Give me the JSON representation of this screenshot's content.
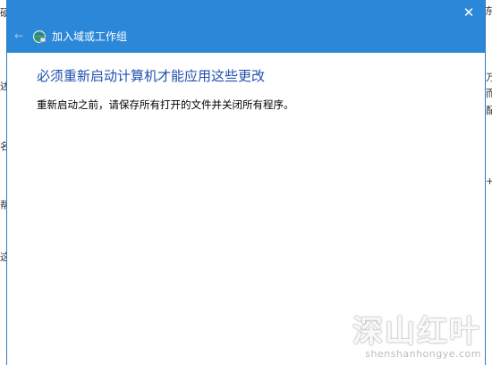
{
  "dialog": {
    "title": "加入域或工作组",
    "close_icon": "✕",
    "back_icon": "←",
    "heading": "必须重新启动计算机才能应用这些更改",
    "message": "重新启动之前，请保存所有打开的文件并关闭所有程序。",
    "accent_color": "#2b88d8",
    "heading_color": "#1f4fae"
  },
  "background": {
    "left_fragments": [
      "硬",
      "述",
      "名",
      "帮",
      "这"
    ],
    "right_fragments": [
      "东",
      "万",
      "而",
      "配",
      "+"
    ]
  },
  "watermark": {
    "cn": "深山红叶",
    "en": "shenshanhongye.com"
  }
}
